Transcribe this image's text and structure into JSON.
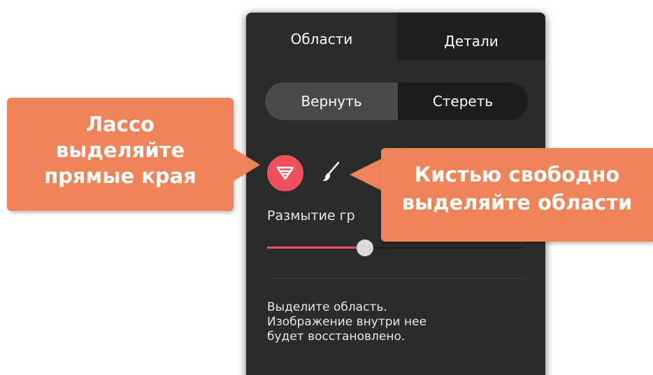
{
  "tabs": [
    {
      "label": "Области",
      "active": true
    },
    {
      "label": "Детали",
      "active": false
    }
  ],
  "mode_toggle": {
    "restore_label": "Вернуть",
    "erase_label": "Стереть",
    "selected": "Вернуть"
  },
  "tools": {
    "lasso_icon": "lasso-icon",
    "brush_icon": "brush-icon",
    "selected": "lasso"
  },
  "blur": {
    "label": "Размытие гр",
    "value_fraction": 0.38
  },
  "hint": {
    "line1": "Выделите область.",
    "line2": "Изображение внутри нее",
    "line3": "будет восстановлено."
  },
  "callouts": {
    "lasso": {
      "line1": "Лассо",
      "line2": "выделяйте",
      "line3": "прямые края"
    },
    "brush": {
      "line1": "Кистью свободно",
      "line2": "выделяйте области"
    }
  },
  "colors": {
    "panel_bg": "#2b2b2b",
    "accent": "#f0505e",
    "callout": "#ef8459"
  }
}
